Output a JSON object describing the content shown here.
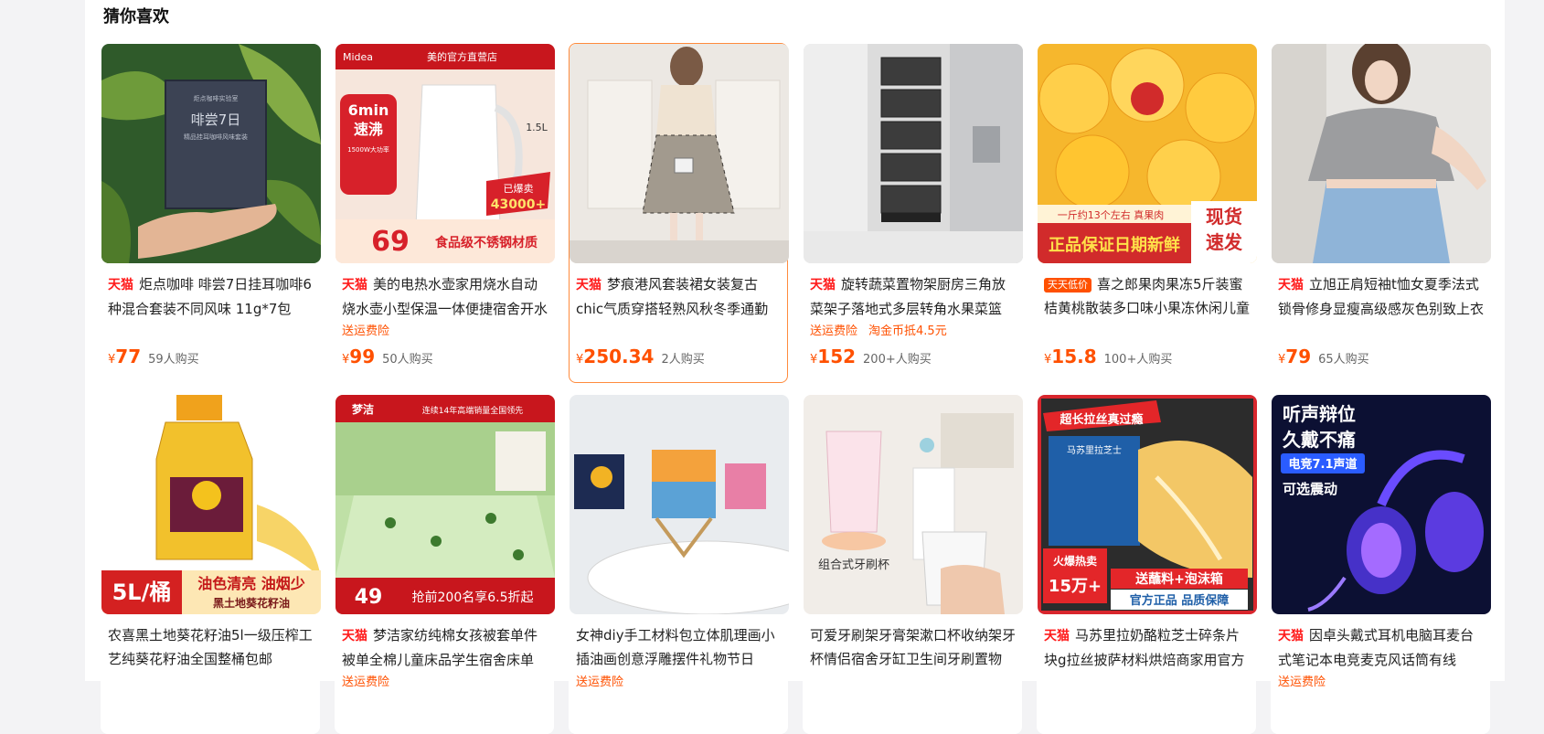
{
  "section": {
    "title": "猜你喜欢"
  },
  "currency_symbol": "¥",
  "products": [
    {
      "tag": "天猫",
      "title": "炬点咖啡 啡尝7日挂耳咖啡6种混合套装不同风味 11g*7包",
      "promos": [],
      "price": "77",
      "sold": "59人购买",
      "image_text": [
        "炬点咖啡实验室",
        "啡尝7日",
        "精品挂耳咖啡风味套装"
      ]
    },
    {
      "tag": "天猫",
      "title": "美的电热水壶家用烧水自动烧水壶小型保温一体便捷宿舍开水壶",
      "promos": [
        "送运费险"
      ],
      "price": "99",
      "sold": "50人购买",
      "image_text": [
        "Midea",
        "美的官方直营店",
        "6min",
        "速沸",
        "1500W大功率",
        "1.5L",
        "已爆卖",
        "43000+",
        "69",
        "食品级不锈钢材质"
      ]
    },
    {
      "tag": "天猫",
      "title": "梦痕港风套装裙女装复古chic气质穿搭轻熟风秋冬季通勤",
      "promos": [],
      "price": "250.34",
      "sold": "2人购买",
      "image_text": []
    },
    {
      "tag": "天猫",
      "title": "旋转蔬菜置物架厨房三角放菜架子落地式多层转角水果菜篮",
      "promos": [
        "送运费险",
        "淘金币抵4.5元"
      ],
      "price": "152",
      "sold": "200+人购买",
      "image_text": []
    },
    {
      "tag": "天天低价",
      "title": "喜之郎果肉果冻5斤装蜜桔黄桃散装多口味小果冻休闲儿童零食",
      "promos": [],
      "price": "15.8",
      "sold": "100+人购买",
      "image_text": [
        "一斤约13个左右 真果肉",
        "现货",
        "速发",
        "正品保证日期新鲜"
      ]
    },
    {
      "tag": "天猫",
      "title": "立旭正肩短袖t恤女夏季法式锁骨修身显瘦高级感灰色别致上衣",
      "promos": [],
      "price": "79",
      "sold": "65人购买",
      "image_text": []
    },
    {
      "tag": "",
      "title": "农喜黑土地葵花籽油5l一级压榨工艺纯葵花籽油全国整桶包邮",
      "promos": [],
      "price": "",
      "sold": "",
      "image_text": [
        "5L/桶",
        "油色清亮 油烟少",
        "黑土地葵花籽油"
      ]
    },
    {
      "tag": "天猫",
      "title": "梦洁家纺纯棉女孩被套单件被单全棉儿童床品学生宿舍床单",
      "promos": [
        "送运费险"
      ],
      "price": "",
      "sold": "",
      "image_text": [
        "梦洁",
        "连续14年高端销量全国领先",
        "49",
        "抢前200名享6.5折起"
      ]
    },
    {
      "tag": "",
      "title": "女神diy手工材料包立体肌理画小插油画创意浮雕摆件礼物节日",
      "promos": [
        "送运费险"
      ],
      "price": "",
      "sold": "",
      "image_text": []
    },
    {
      "tag": "",
      "title": "可爱牙刷架牙膏架漱口杯收纳架牙杯情侣宿舍牙缸卫生间牙刷置物",
      "promos": [],
      "price": "",
      "sold": "",
      "image_text": [
        "组合式牙刷杯"
      ]
    },
    {
      "tag": "天猫",
      "title": "马苏里拉奶酪粒芝士碎条片块g拉丝披萨材料烘焙商家用官方旗舰店",
      "promos": [],
      "price": "",
      "sold": "",
      "image_text": [
        "超长拉丝真过瘾",
        "马苏里拉芝士",
        "火爆热卖",
        "15万+",
        "送蘸料+泡沫箱",
        "官方正品 品质保障"
      ]
    },
    {
      "tag": "天猫",
      "title": "因卓头戴式耳机电脑耳麦台式笔记本电竞麦克风话筒有线",
      "promos": [
        "送运费险"
      ],
      "price": "",
      "sold": "",
      "image_text": [
        "听声辩位",
        "久戴不痛",
        "电竞7.1声道",
        "可选震动"
      ]
    }
  ]
}
